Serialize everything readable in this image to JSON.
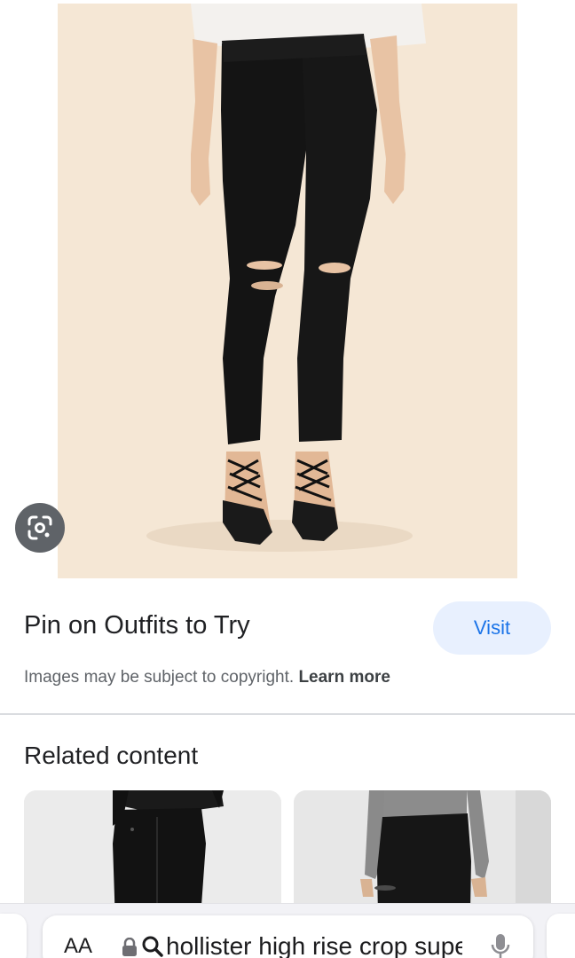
{
  "result": {
    "title": "Pin on Outfits to Try",
    "visit_label": "Visit",
    "copyright_text": "Images may be subject to copyright.",
    "learn_more_label": "Learn more"
  },
  "related": {
    "heading": "Related content"
  },
  "browser": {
    "text_size_label": "AA",
    "address_text": "hollister high rise crop super skinny jeans"
  },
  "icons": {
    "lens": "google-lens-icon",
    "lock": "lock-icon",
    "search": "search-icon",
    "mic": "microphone-icon"
  },
  "colors": {
    "accent": "#1a73e8",
    "visit_bg": "#e8f0fe",
    "photo_bg": "#f5e7d5"
  }
}
